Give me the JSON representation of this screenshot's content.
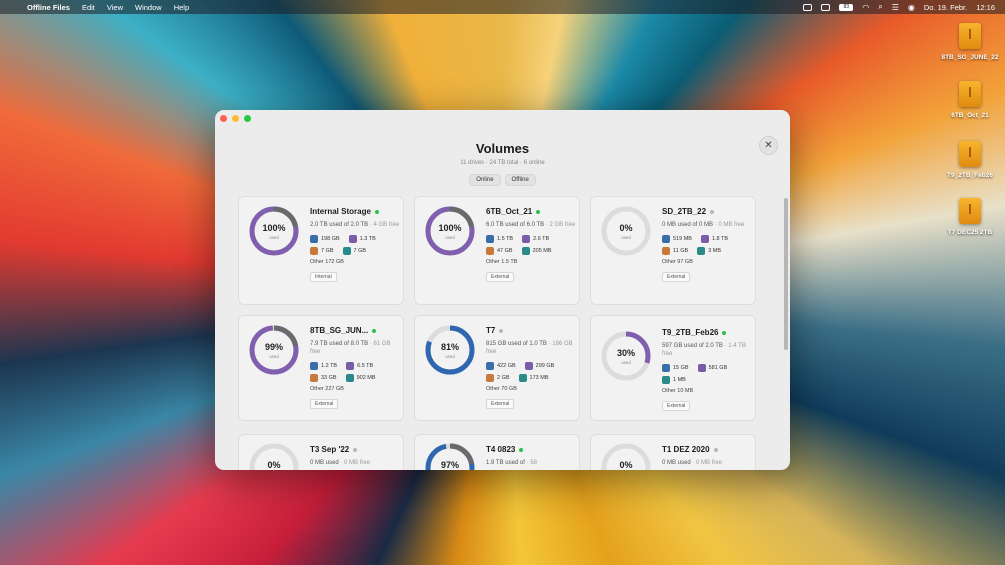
{
  "menubar": {
    "app": "Offline Files",
    "menus": [
      "Edit",
      "View",
      "Window",
      "Help"
    ],
    "battery": "83",
    "date": "Do. 19. Febr.",
    "time": "12:16"
  },
  "desktop": [
    {
      "label": "8TB_SG_JUNE_22"
    },
    {
      "label": "6TB_Oct_21"
    },
    {
      "label": "T9_2TB_Feb26"
    },
    {
      "label": "T7 DEC25 2TB"
    }
  ],
  "window": {
    "title": "Volumes",
    "subtitle": "11 drives · 24 TB total · 6 online",
    "filters": [
      "Online",
      "Offline"
    ]
  },
  "colors": {
    "online": "#2fbf4a",
    "offline": "#b8b8b8",
    "used": "#7f5fae",
    "used_alt": "#2e66b0"
  },
  "volumes": [
    {
      "name": "Internal Storage",
      "online": true,
      "pct": "100%",
      "used_label": "used",
      "used": "2.0 TB used of 2.0 TB",
      "free": "· 4 GB free",
      "stats": [
        {
          "icon": "video",
          "v": "198 GB"
        },
        {
          "icon": "document",
          "v": "1.3 TB"
        },
        {
          "icon": "image",
          "v": "7 GB"
        },
        {
          "icon": "music",
          "v": "7 GB"
        }
      ],
      "other": "Other  172 GB",
      "kind": "Internal"
    },
    {
      "name": "6TB_Oct_21",
      "online": true,
      "pct": "100%",
      "used_label": "used",
      "used": "6.0 TB used of 6.0 TB",
      "free": "· 2 GB free",
      "stats": [
        {
          "icon": "video",
          "v": "1.5 TB"
        },
        {
          "icon": "document",
          "v": "2.6 TB"
        },
        {
          "icon": "image",
          "v": "47 GB"
        },
        {
          "icon": "music",
          "v": "205 MB"
        }
      ],
      "other": "Other  1.5 TB",
      "kind": "External"
    },
    {
      "name": "SD_2TB_22",
      "online": false,
      "pct": "0%",
      "used_label": "used",
      "used": "0 MB used of 0 MB",
      "free": "· 0 MB free",
      "stats": [
        {
          "icon": "video",
          "v": "519 MB"
        },
        {
          "icon": "document",
          "v": "1.8 TB"
        },
        {
          "icon": "image",
          "v": "11 GB"
        },
        {
          "icon": "music",
          "v": "3 MB"
        }
      ],
      "other": "Other  97 GB",
      "kind": "External"
    },
    {
      "name": "8TB_SG_JUN...",
      "online": true,
      "pct": "99%",
      "used_label": "used",
      "used": "7.9 TB used of 8.0 TB",
      "free": "· 61 GB free",
      "stats": [
        {
          "icon": "video",
          "v": "1.2 TB"
        },
        {
          "icon": "document",
          "v": "6.5 TB"
        },
        {
          "icon": "image",
          "v": "33 GB"
        },
        {
          "icon": "music",
          "v": "902 MB"
        }
      ],
      "other": "Other  227 GB",
      "kind": "External"
    },
    {
      "name": "T7",
      "online": false,
      "pct": "81%",
      "used_label": "used",
      "used": "815 GB used of 1.0 TB",
      "free": "· 186 GB free",
      "stats": [
        {
          "icon": "video",
          "v": "422 GB"
        },
        {
          "icon": "document",
          "v": "299 GB"
        },
        {
          "icon": "image",
          "v": "2 GB"
        },
        {
          "icon": "music",
          "v": "173 MB"
        }
      ],
      "other": "Other  70 GB",
      "kind": "External"
    },
    {
      "name": "T9_2TB_Feb26",
      "online": true,
      "pct": "30%",
      "used_label": "used",
      "used": "597 GB used of 2.0 TB",
      "free": "· 1.4 TB free",
      "stats": [
        {
          "icon": "video",
          "v": "15 GB"
        },
        {
          "icon": "document",
          "v": "581 GB"
        },
        {
          "icon": "music",
          "v": "1 MB"
        }
      ],
      "other": "Other  10 MB",
      "kind": "External"
    },
    {
      "name": "T3 Sep '22",
      "online": false,
      "pct": "0%",
      "used_label": "used",
      "used": "0 MB used",
      "free": "· 0 MB free",
      "stats": [],
      "other": "",
      "kind": ""
    },
    {
      "name": "T4 0823",
      "online": true,
      "pct": "97%",
      "used_label": "used",
      "used": "1.9 TB used of",
      "free": "· 58",
      "stats": [],
      "other": "",
      "kind": ""
    },
    {
      "name": "T1 DEZ 2020",
      "online": false,
      "pct": "0%",
      "used_label": "used",
      "used": "0 MB used",
      "free": "· 0 MB free",
      "stats": [],
      "other": "",
      "kind": ""
    }
  ]
}
